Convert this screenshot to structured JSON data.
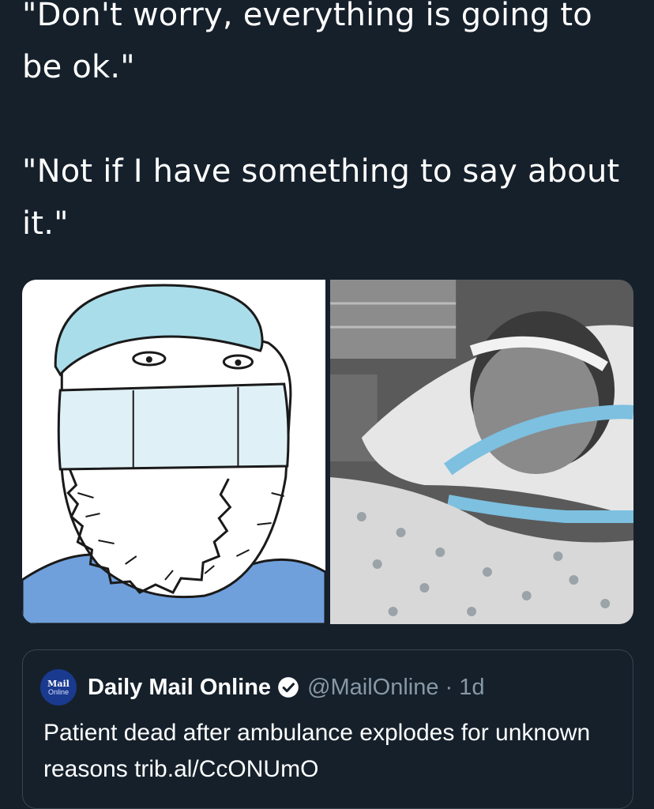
{
  "tweet": {
    "line1": "\"Don't worry, everything is going to be ok.\"",
    "line2": "\"Not if I have something to say about it.\""
  },
  "media": {
    "left_image": "wojak-doctor-mask-meme-icon",
    "right_image": "patient-on-ventilator-photo"
  },
  "quoted_tweet": {
    "avatar_line1": "Mail",
    "avatar_line2": "Online",
    "author": "Daily Mail Online",
    "handle": "@MailOnline",
    "separator": "·",
    "time": "1d",
    "text": "Patient dead after ambulance explodes for unknown reasons trib.al/CcONUmO"
  },
  "colors": {
    "background": "#15202b",
    "verified_badge": "#ffffff",
    "border": "#38444d",
    "muted_text": "#8899a6"
  }
}
